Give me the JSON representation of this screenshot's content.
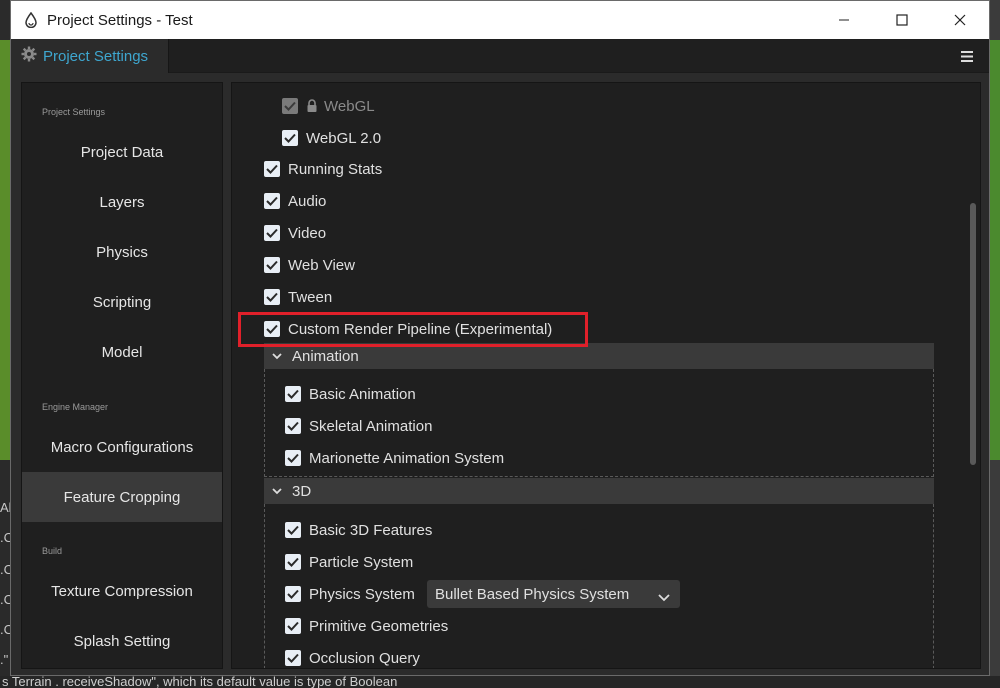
{
  "window": {
    "title": "Project Settings - Test",
    "tab_label": "Project Settings"
  },
  "background": {
    "bottom_text": "s Terrain . receiveShadow\", which its default value is type of Boolean",
    "left_glyphs": [
      "Al",
      ".C",
      ".C",
      ".C",
      ".C",
      ".\""
    ]
  },
  "sidebar": {
    "sections": [
      {
        "label": "Project Settings"
      },
      {
        "label": "Engine Manager"
      },
      {
        "label": "Build"
      }
    ],
    "items": [
      {
        "label": "Project Data"
      },
      {
        "label": "Layers"
      },
      {
        "label": "Physics"
      },
      {
        "label": "Scripting"
      },
      {
        "label": "Model"
      },
      {
        "label": "Macro Configurations"
      },
      {
        "label": "Feature Cropping",
        "active": true
      },
      {
        "label": "Texture Compression"
      },
      {
        "label": "Splash Setting"
      }
    ]
  },
  "features": {
    "webgl": {
      "label": "WebGL",
      "checked": true,
      "locked": true
    },
    "webgl2": {
      "label": "WebGL 2.0",
      "checked": true
    },
    "top_level": [
      {
        "label": "Running Stats",
        "checked": true
      },
      {
        "label": "Audio",
        "checked": true
      },
      {
        "label": "Video",
        "checked": true
      },
      {
        "label": "Web View",
        "checked": true
      },
      {
        "label": "Tween",
        "checked": true
      },
      {
        "label": "Custom Render Pipeline (Experimental)",
        "checked": true,
        "highlighted": true
      }
    ],
    "animation_group": {
      "title": "Animation",
      "expanded": true,
      "items": [
        {
          "label": "Basic Animation",
          "checked": true
        },
        {
          "label": "Skeletal Animation",
          "checked": true
        },
        {
          "label": "Marionette Animation System",
          "checked": true
        }
      ]
    },
    "three_d_group": {
      "title": "3D",
      "expanded": true,
      "items": [
        {
          "label": "Basic 3D Features",
          "checked": true
        },
        {
          "label": "Particle System",
          "checked": true
        },
        {
          "label": "Physics System",
          "checked": true,
          "select_value": "Bullet Based Physics System"
        },
        {
          "label": "Primitive Geometries",
          "checked": true
        },
        {
          "label": "Occlusion Query",
          "checked": true
        }
      ]
    }
  },
  "colors": {
    "accent": "#3ea6cf",
    "highlight_border": "#e0202a",
    "panel_bg": "#1f1f1f"
  }
}
